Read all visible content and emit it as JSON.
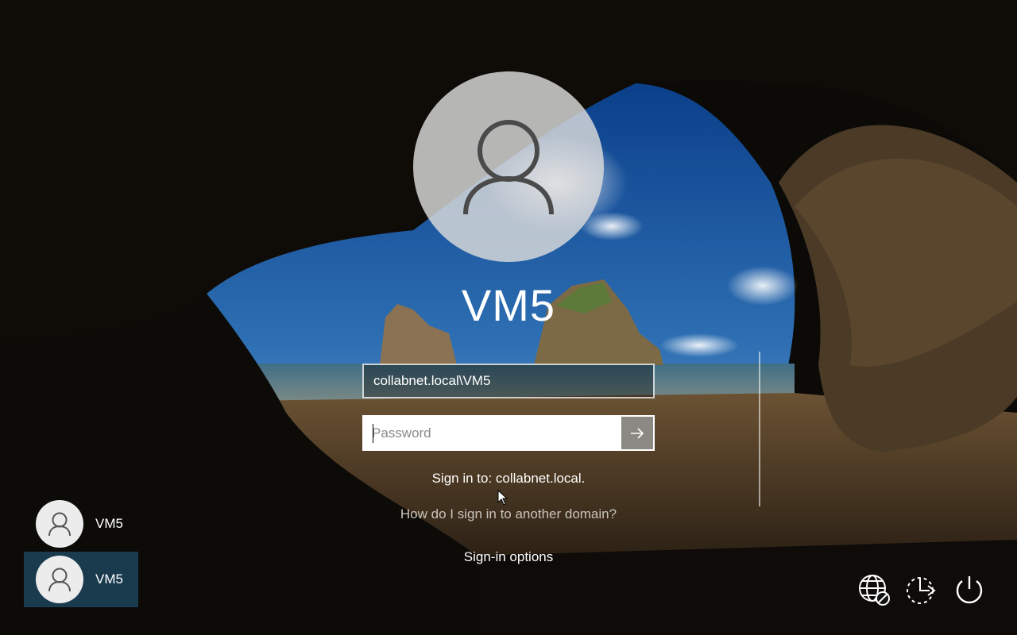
{
  "login": {
    "username": "VM5",
    "domain_user_value": "collabnet.local\\VM5",
    "password_placeholder": "Password",
    "sign_in_to": "Sign in to: collabnet.local.",
    "other_domain_link": "How do I sign in to another domain?",
    "signin_options": "Sign-in options",
    "submit_icon": "arrow-right-icon"
  },
  "users": [
    {
      "label": "VM5",
      "selected": false,
      "icon": "user-icon"
    },
    {
      "label": "VM5",
      "selected": true,
      "icon": "user-icon"
    }
  ],
  "system_icons": [
    {
      "name": "network-icon"
    },
    {
      "name": "ease-of-access-icon"
    },
    {
      "name": "power-icon"
    }
  ],
  "colors": {
    "selected_tile": "#1a3a4e",
    "submit_button": "#8c8984"
  }
}
